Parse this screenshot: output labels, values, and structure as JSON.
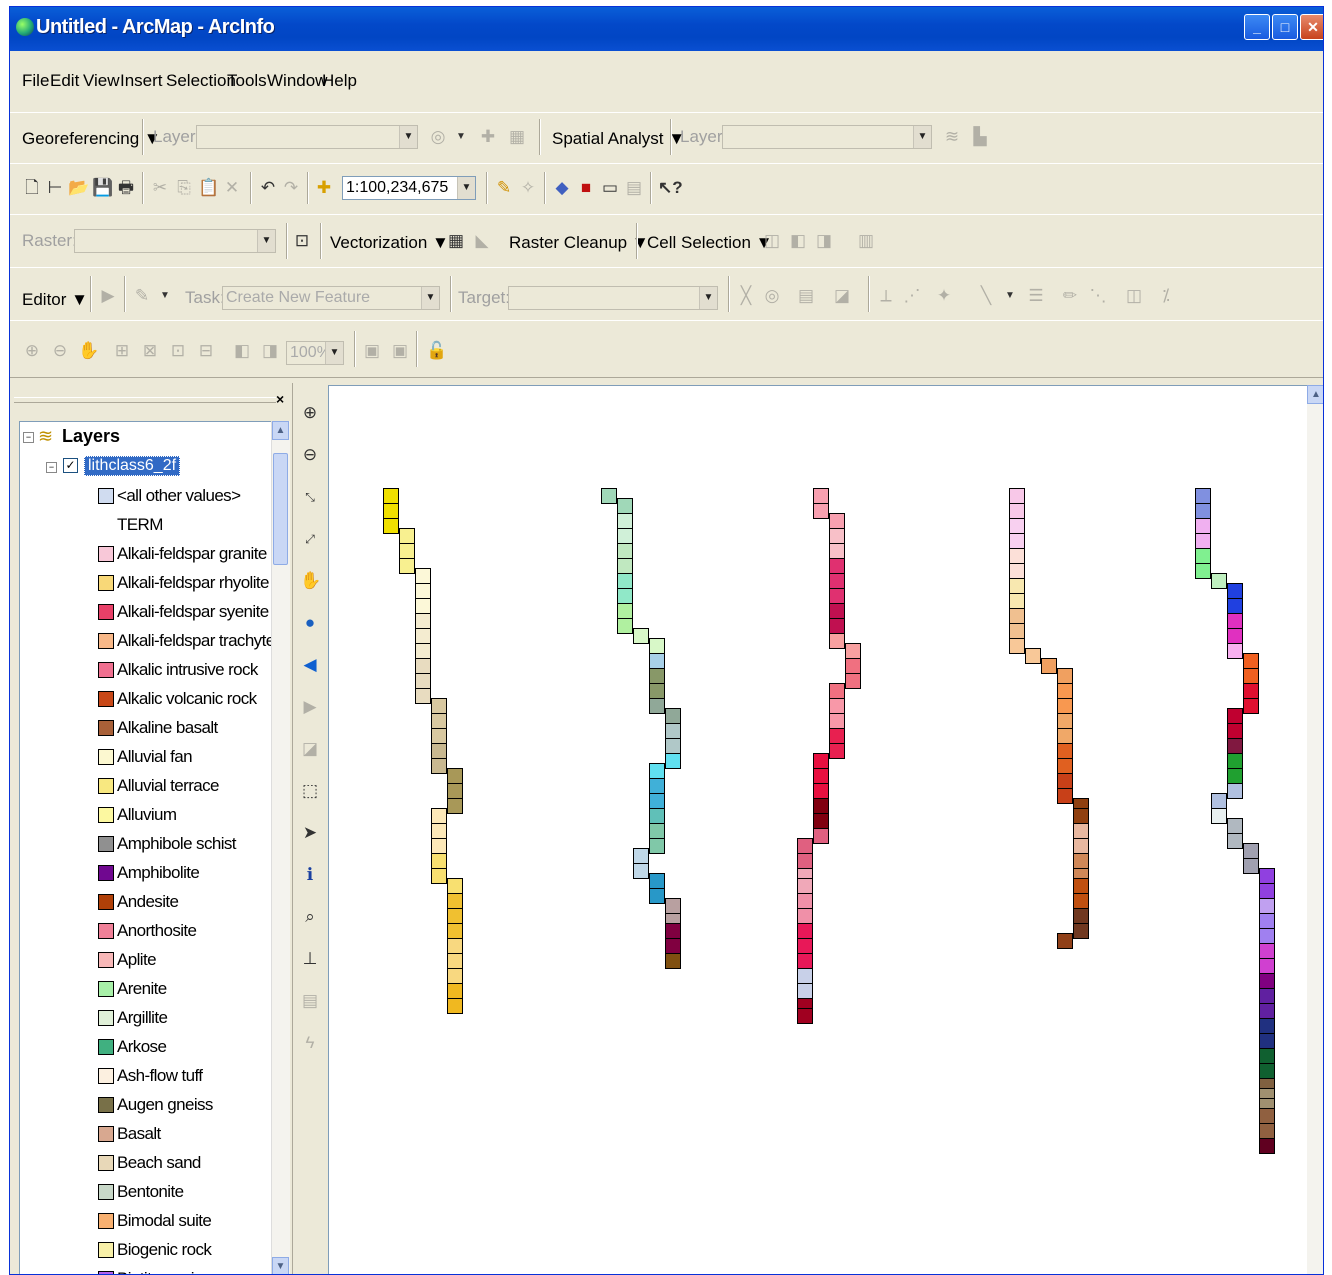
{
  "window": {
    "title": "Untitled - ArcMap - ArcInfo"
  },
  "menu": [
    "File",
    "Edit",
    "View",
    "Insert",
    "Selection",
    "Tools",
    "Window",
    "Help"
  ],
  "georef": {
    "label": "Georeferencing ▼",
    "layer_label": "Layer:",
    "spatial_analyst": "Spatial Analyst ▼",
    "layer2_label": "Layer:"
  },
  "standard": {
    "scale": "1:100,234,675"
  },
  "raster": {
    "raster_label": "Raster:",
    "vectorization": "Vectorization ▼",
    "cleanup": "Raster Cleanup ▼",
    "cell_selection": "Cell Selection ▼"
  },
  "editor": {
    "editor": "Editor ▼",
    "task_label": "Task:",
    "task_value": "Create New Feature",
    "target_label": "Target:"
  },
  "layout": {
    "zoom": "100%"
  },
  "toc": {
    "root": "Layers",
    "layer": "lithclass6_2f",
    "other_values": "<all other values>",
    "field": "TERM",
    "items": [
      {
        "label": "Alkali-feldspar granite",
        "color": "#f8c8d8"
      },
      {
        "label": "Alkali-feldspar rhyolite",
        "color": "#f8d878"
      },
      {
        "label": "Alkali-feldspar syenite",
        "color": "#e84068"
      },
      {
        "label": "Alkali-feldspar trachyte",
        "color": "#f8b888"
      },
      {
        "label": "Alkalic intrusive rock",
        "color": "#f07090"
      },
      {
        "label": "Alkalic volcanic rock",
        "color": "#c84818"
      },
      {
        "label": "Alkaline basalt",
        "color": "#a86038"
      },
      {
        "label": "Alluvial fan",
        "color": "#fcf8d0"
      },
      {
        "label": "Alluvial terrace",
        "color": "#f8e880"
      },
      {
        "label": "Alluvium",
        "color": "#fcf8a0"
      },
      {
        "label": "Amphibole schist",
        "color": "#909090"
      },
      {
        "label": "Amphibolite",
        "color": "#700890"
      },
      {
        "label": "Andesite",
        "color": "#b04008"
      },
      {
        "label": "Anorthosite",
        "color": "#f08098"
      },
      {
        "label": "Aplite",
        "color": "#f8b8b8"
      },
      {
        "label": "Arenite",
        "color": "#a8f0a8"
      },
      {
        "label": "Argillite",
        "color": "#e0f0d8"
      },
      {
        "label": "Arkose",
        "color": "#40b080"
      },
      {
        "label": "Ash-flow tuff",
        "color": "#fcf0e0"
      },
      {
        "label": "Augen gneiss",
        "color": "#787048"
      },
      {
        "label": "Basalt",
        "color": "#d8a890"
      },
      {
        "label": "Beach sand",
        "color": "#e8d8b8"
      },
      {
        "label": "Bentonite",
        "color": "#c8d8c8"
      },
      {
        "label": "Bimodal suite",
        "color": "#f8b070"
      },
      {
        "label": "Biogenic rock",
        "color": "#f8f0a8"
      },
      {
        "label": "Biotite gneiss",
        "color": "#b060f0"
      }
    ]
  },
  "map": {
    "columns": [
      {
        "palette": [
          "#f0e000",
          "#f8f090",
          "#fcf8d8",
          "#f4ecd0",
          "#e8dcc0",
          "#d8c8a0",
          "#c8b890",
          "#a89858",
          "#fce8b8",
          "#f8e070",
          "#f0c030",
          "#f8d880",
          "#f0b820"
        ]
      },
      {
        "palette": [
          "#a0d8b8",
          "#d0f0d8",
          "#c0e8c0",
          "#90e8c8",
          "#b0f0a0",
          "#d8f8c8",
          "#a8d0e8",
          "#889868",
          "#90a898",
          "#b0c8c8",
          "#60e0f0",
          "#40b0d8",
          "#60c0b8",
          "#80c8a8",
          "#c0d8e8",
          "#2898c8",
          "#b8a0a0",
          "#800040",
          "#805010"
        ]
      },
      {
        "palette": [
          "#f8a0b0",
          "#f8c0c8",
          "#e03070",
          "#c01050",
          "#f8a0a0",
          "#f07080",
          "#f898a8",
          "#e82050",
          "#e81040",
          "#800010",
          "#e06080",
          "#f0a8b8",
          "#f090a8",
          "#e81858",
          "#c8d0e8",
          "#a00020"
        ]
      },
      {
        "palette": [
          "#f8c8e8",
          "#f8d0f0",
          "#fce0d8",
          "#f8e8b0",
          "#f0c090",
          "#f8c898",
          "#f0a060",
          "#f89850",
          "#f0a868",
          "#e06020",
          "#c84018",
          "#904010",
          "#e8b8a0",
          "#d08858",
          "#c05010",
          "#703820",
          "#904018"
        ]
      },
      {
        "palette": [
          "#8090e0",
          "#f0b0f0",
          "#80f090",
          "#c0f0c0",
          "#2040e0",
          "#e030c0",
          "#f8b0f0",
          "#f06020",
          "#e01030",
          "#c00030",
          "#801840",
          "#20a030",
          "#b0c0e0",
          "#e8f0f0",
          "#b0b8c0",
          "#a0a0b0",
          "#9040e0",
          "#c0a0f0",
          "#a080f0",
          "#d040d0",
          "#800080",
          "#6020a0",
          "#203080",
          "#106030",
          "#806040",
          "#a09070",
          "#906040",
          "#600020"
        ]
      }
    ]
  }
}
